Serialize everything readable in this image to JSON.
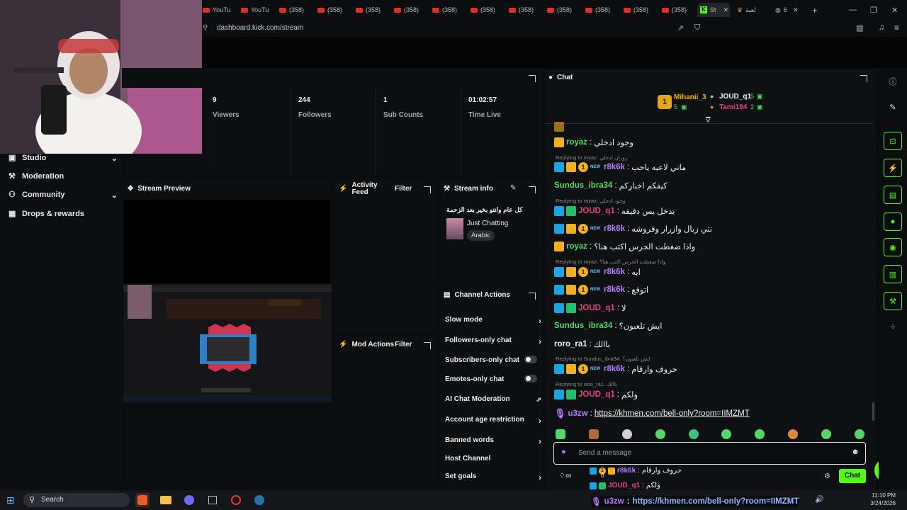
{
  "browser": {
    "tabs": [
      {
        "label": "YouTu",
        "type": "youtube"
      },
      {
        "label": "YouTu",
        "type": "youtube"
      },
      {
        "label": "(358)",
        "type": "youtube"
      },
      {
        "label": "(358)",
        "type": "youtube"
      },
      {
        "label": "(358)",
        "type": "youtube"
      },
      {
        "label": "(358)",
        "type": "youtube"
      },
      {
        "label": "(358)",
        "type": "youtube"
      },
      {
        "label": "(358)",
        "type": "youtube"
      },
      {
        "label": "(358)",
        "type": "youtube"
      },
      {
        "label": "(358)",
        "type": "youtube"
      },
      {
        "label": "(358)",
        "type": "youtube"
      },
      {
        "label": "(358)",
        "type": "youtube"
      },
      {
        "label": "(358)",
        "type": "youtube"
      },
      {
        "label": "St",
        "type": "kick"
      },
      {
        "label": "لعبة",
        "type": "other"
      },
      {
        "label": "6",
        "type": "other"
      }
    ],
    "url": "dashboard.kick.com/stream"
  },
  "nav": {
    "items": [
      {
        "label": "Studio",
        "icon": "studio-icon",
        "expandable": true
      },
      {
        "label": "Moderation",
        "icon": "wrench-icon",
        "expandable": false
      },
      {
        "label": "Community",
        "icon": "community-icon",
        "expandable": true
      },
      {
        "label": "Drops & rewards",
        "icon": "drops-icon",
        "expandable": false
      }
    ]
  },
  "stats": [
    {
      "value": "9",
      "label": "Viewers"
    },
    {
      "value": "244",
      "label": "Followers"
    },
    {
      "value": "1",
      "label": "Sub Counts"
    },
    {
      "value": "01:02:57",
      "label": "Time Live"
    }
  ],
  "panels": {
    "stream_preview": "Stream Preview",
    "activity_feed": "Activity Feed",
    "mod_actions": "Mod Actions",
    "filter": "Filter",
    "stream_info": {
      "title": "Stream info",
      "stream_title": "كل عام وانتو بخير بعد الزحمة",
      "category": "Just Chatting",
      "language": "Arabic"
    },
    "channel_actions": {
      "title": "Channel Actions",
      "items": [
        {
          "label": "Slow mode",
          "control": "chevron"
        },
        {
          "label": "Followers-only chat",
          "control": "chevron"
        },
        {
          "label": "Subscribers-only chat",
          "control": "toggle"
        },
        {
          "label": "Emotes-only chat",
          "control": "toggle"
        },
        {
          "label": "AI Chat Moderation",
          "control": "external"
        },
        {
          "label": "Account age restriction",
          "control": "chevron"
        },
        {
          "label": "Banned words",
          "control": "chevron"
        },
        {
          "label": "Host Channel",
          "control": "none"
        },
        {
          "label": "Set goals",
          "control": "chevron"
        }
      ]
    }
  },
  "chat": {
    "title": "Chat",
    "top_gifters": [
      {
        "name": "Mihanii_3",
        "count": "5",
        "rank": "1"
      },
      {
        "name": "JOUD_q1",
        "count": "5"
      },
      {
        "name": "Tami194",
        "count": "2"
      }
    ],
    "messages": [
      {
        "user": "royaz",
        "text": "وجود ادخلي",
        "color": "#53d769",
        "badges": [
          "crown"
        ]
      },
      {
        "reply": "Replying to royaz: روزان ادخلي"
      },
      {
        "user": "r8k6k",
        "text": "ماني لاعبه ياحب",
        "color": "#b37cff",
        "badges": [
          "blue",
          "crown",
          "gold",
          "new"
        ]
      },
      {
        "user": "Sundus_ibra34",
        "text": "كيفكم اخباركم",
        "color": "#53d769",
        "badges": []
      },
      {
        "reply": "Replying to royaz: وجود ادخلي"
      },
      {
        "user": "JOUD_q1",
        "text": "بدخل بس دقيقه",
        "color": "#e0457b",
        "badges": [
          "blue",
          "green"
        ]
      },
      {
        "user": "r8k6k",
        "text": "نتي زبال وازرار وقروشه",
        "color": "#b37cff",
        "badges": [
          "blue",
          "crown",
          "gold",
          "new"
        ]
      },
      {
        "user": "royaz",
        "text": "واذا ضغطت الجرس اكتب هنا؟",
        "color": "#53d769",
        "badges": [
          "crown"
        ]
      },
      {
        "reply": "Replying to royaz: واذا ضغطت الجرس اكتب هنا؟"
      },
      {
        "user": "r8k6k",
        "text": "ايه",
        "color": "#b37cff",
        "badges": [
          "blue",
          "crown",
          "gold",
          "new"
        ]
      },
      {
        "user": "r8k6k",
        "text": "اتوقع",
        "color": "#b37cff",
        "badges": [
          "blue",
          "crown",
          "gold",
          "new"
        ]
      },
      {
        "user": "JOUD_q1",
        "text": "لا",
        "color": "#e0457b",
        "badges": [
          "blue",
          "green"
        ]
      },
      {
        "user": "Sundus_ibra34",
        "text": "ايش تلعبون؟",
        "color": "#53d769",
        "badges": []
      },
      {
        "user": "roro_ra1",
        "text": "باالك",
        "color": "#f0f0f0",
        "badges": []
      },
      {
        "reply": "Replying to Sundus_ibra34: ايش تلعبون؟"
      },
      {
        "user": "r8k6k",
        "text": "حروف وارقام",
        "color": "#b37cff",
        "badges": [
          "blue",
          "crown",
          "gold",
          "new"
        ]
      },
      {
        "reply": "Replying to roro_ra1: باالك"
      },
      {
        "user": "JOUD_q1",
        "text": "ولكم",
        "color": "#e0457b",
        "badges": [
          "blue",
          "green"
        ]
      },
      {
        "user": "u3zw",
        "text": "https://khmen.com/bell-only?room=IIMZMT",
        "color": "#b37cff",
        "badges": [
          "mic"
        ],
        "link": true
      }
    ],
    "input_placeholder": "Send a message",
    "send_label": "Chat",
    "pinned_overlay": [
      {
        "user": "r8k6k",
        "text": "حروف وارقام",
        "count": "0"
      },
      {
        "user": "JOUD_q1",
        "text": "ولكم"
      }
    ],
    "overlay_link": {
      "user": "u3zw",
      "text": "https://khmen.com/bell-only?room=IIMZMT"
    }
  },
  "taskbar": {
    "search": "Search",
    "time": "11:10 PM",
    "date": "3/24/2026"
  },
  "colors": {
    "kick_green": "#53fc18",
    "panel_bg": "#0d0e10",
    "chat_bg": "#0f1012"
  }
}
